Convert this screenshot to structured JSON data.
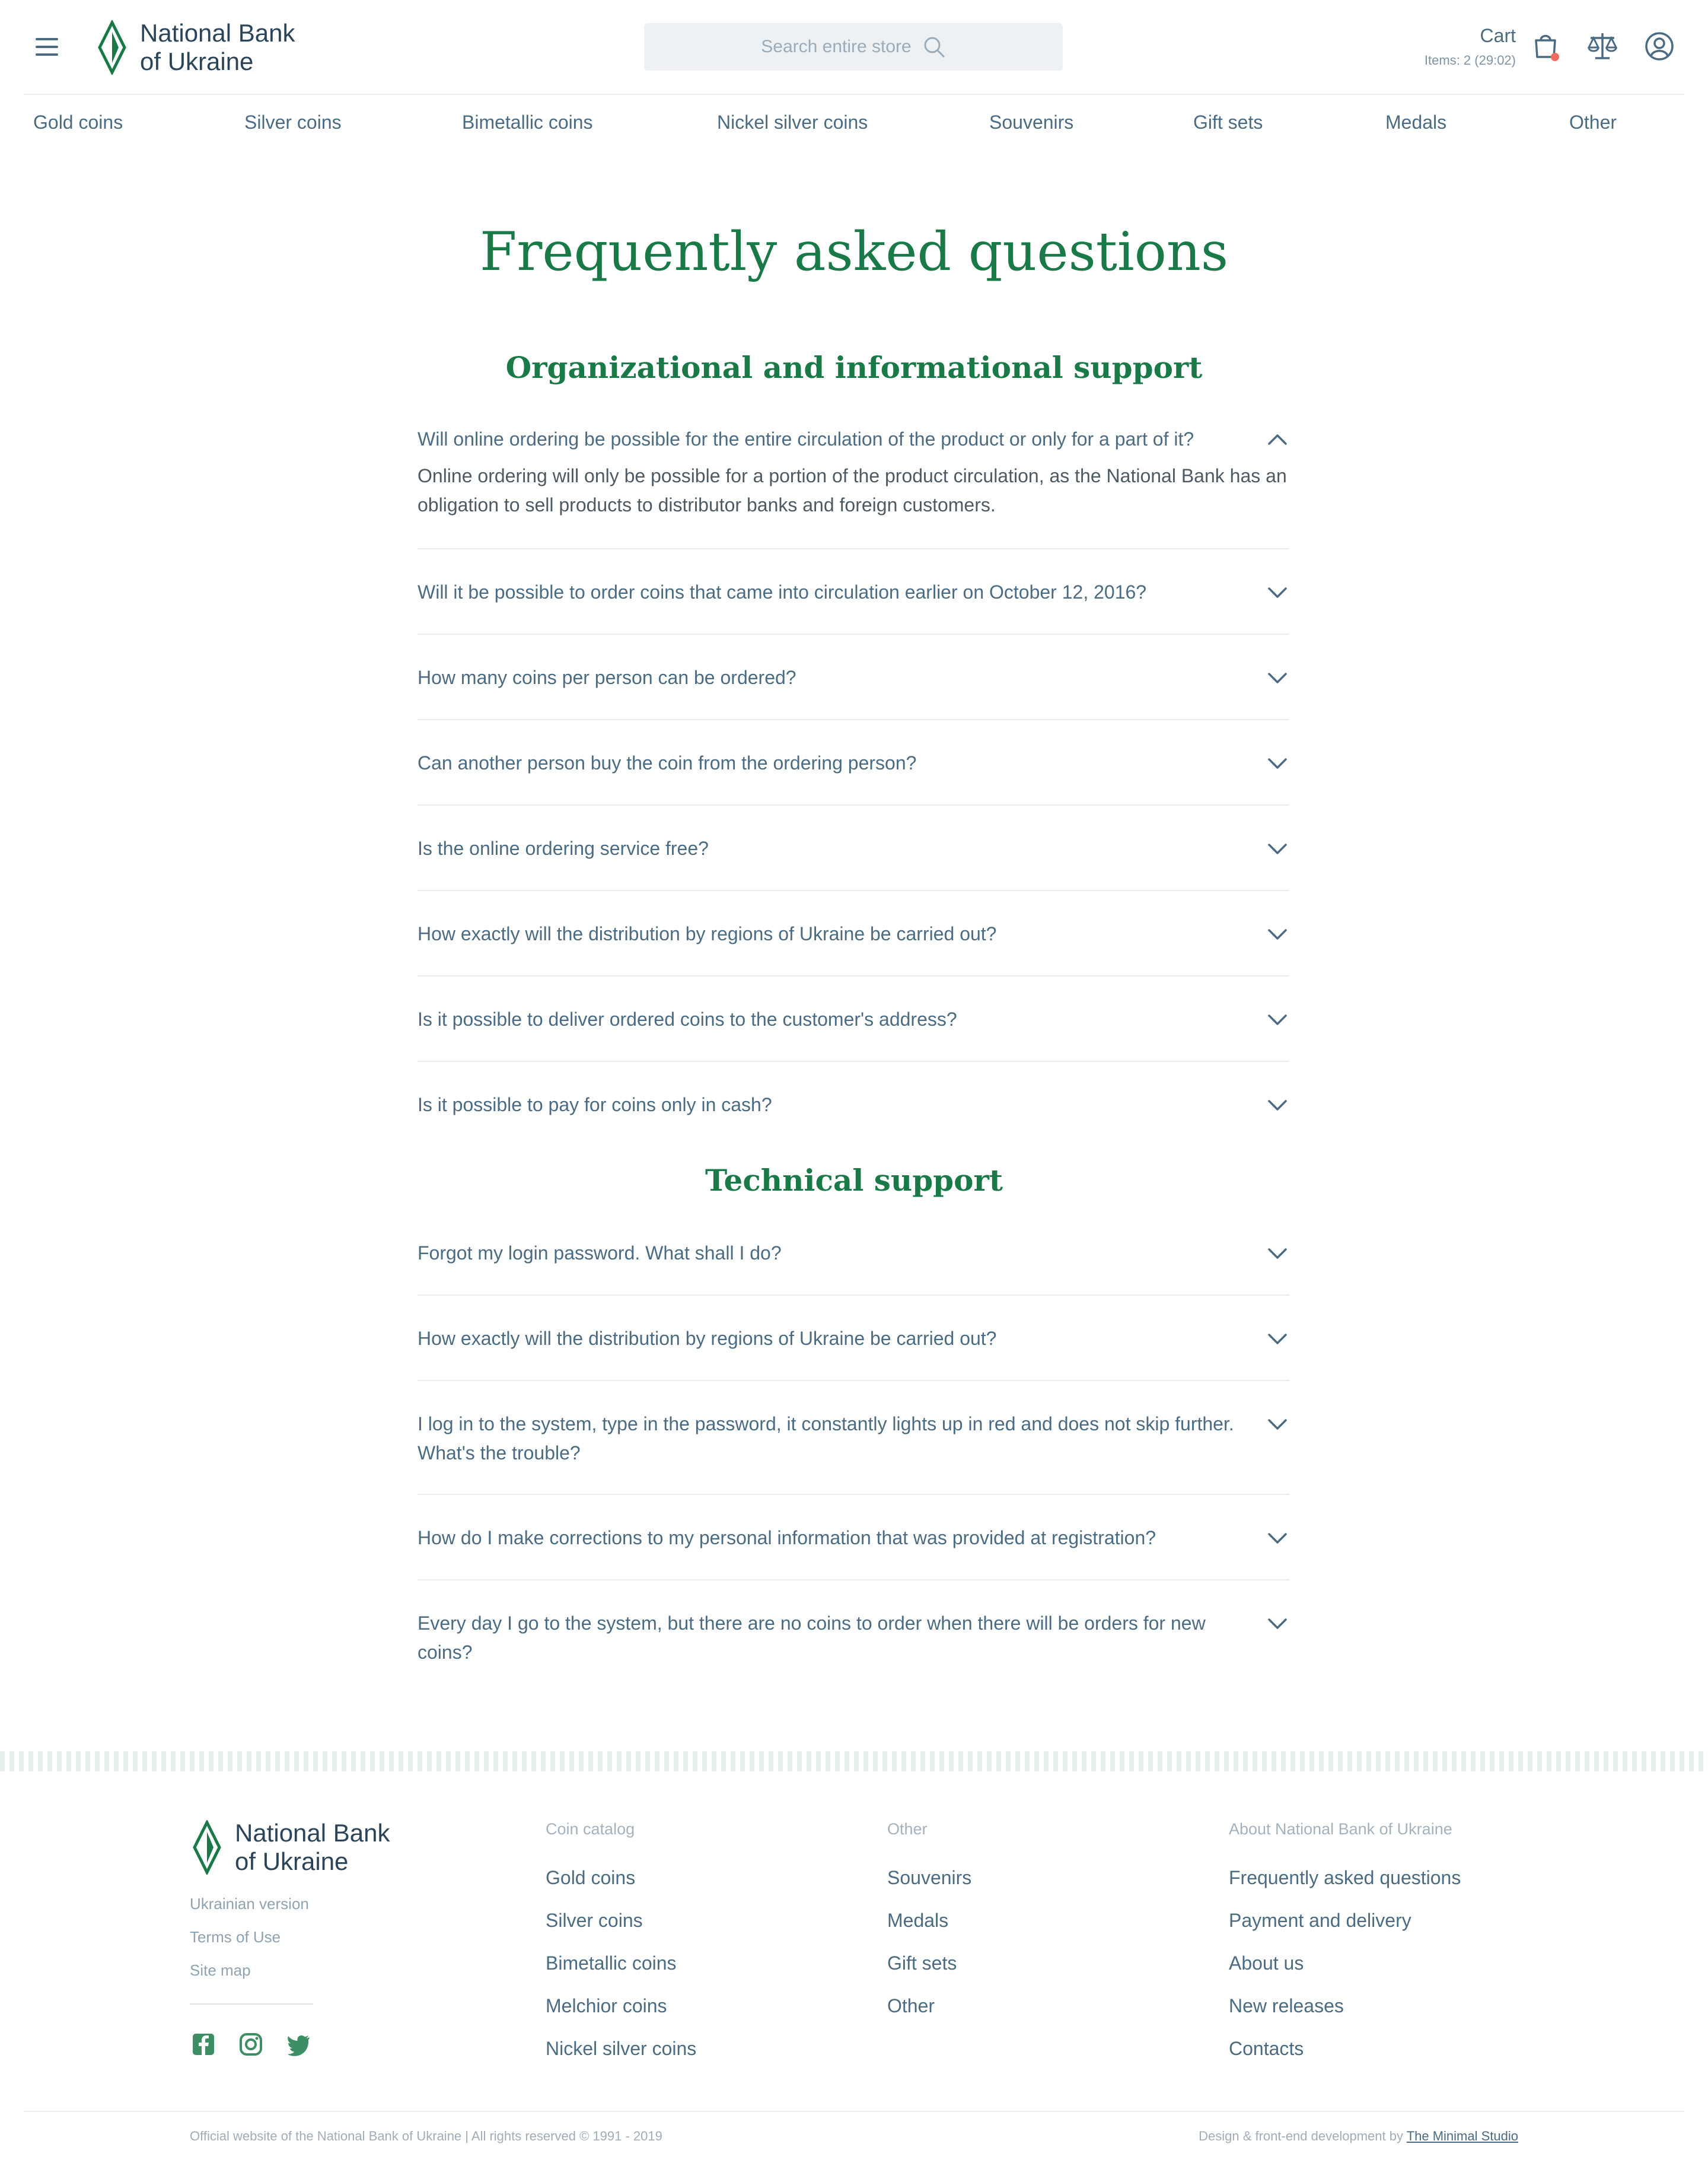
{
  "header": {
    "logo_line1": "National Bank",
    "logo_line2": "of Ukraine",
    "search_placeholder": "Search entire store",
    "cart_label": "Cart",
    "cart_items": "Items: 2 (29:02)",
    "accent_color": "#1a7a47",
    "badge_color": "#f06b5f"
  },
  "nav": {
    "items": [
      "Gold coins",
      "Silver coins",
      "Bimetallic coins",
      "Nickel silver coins",
      "Souvenirs",
      "Gift sets",
      "Medals",
      "Other"
    ]
  },
  "main": {
    "title": "Frequently asked questions",
    "sections": [
      {
        "title": "Organizational and informational support",
        "items": [
          {
            "question": "Will online ordering be possible for the entire circulation of the product or only for a part of it?",
            "answer": "Online ordering will only be possible for a portion of the product circulation, as the National Bank has an obligation to sell products to distributor banks and foreign customers.",
            "expanded": true
          },
          {
            "question": "Will it be possible to order coins that came into circulation earlier on October 12, 2016?",
            "expanded": false
          },
          {
            "question": "How many coins per person can be ordered?",
            "expanded": false
          },
          {
            "question": "Can another person buy the coin from the ordering person?",
            "expanded": false
          },
          {
            "question": "Is the online ordering service free?",
            "expanded": false
          },
          {
            "question": "How exactly will the distribution by regions of Ukraine be carried out?",
            "expanded": false
          },
          {
            "question": "Is it possible to deliver ordered coins to the customer's address?",
            "expanded": false
          },
          {
            "question": "Is it possible to pay for coins only in cash?",
            "expanded": false
          }
        ]
      },
      {
        "title": "Technical support",
        "items": [
          {
            "question": "Forgot my login password. What shall I do?",
            "expanded": false
          },
          {
            "question": "How exactly will the distribution by regions of Ukraine be carried out?",
            "expanded": false
          },
          {
            "question": "I log in to the system, type in the password, it constantly lights up in red and does not skip further. What's the trouble?",
            "expanded": false
          },
          {
            "question": "How do I make corrections to my personal information that was provided at registration?",
            "expanded": false
          },
          {
            "question": "Every day I go to the system, but there are no coins to order when there will be orders for new coins?",
            "expanded": false
          }
        ]
      }
    ]
  },
  "footer": {
    "logo_line1": "National Bank",
    "logo_line2": "of Ukraine",
    "side_links": [
      "Ukrainian version",
      "Terms of Use",
      "Site map"
    ],
    "social": [
      "facebook-icon",
      "instagram-icon",
      "twitter-icon"
    ],
    "columns": [
      {
        "heading": "Coin catalog",
        "links": [
          "Gold coins",
          "Silver coins",
          "Bimetallic coins",
          "Melchior coins",
          "Nickel silver coins"
        ]
      },
      {
        "heading": "Other",
        "links": [
          "Souvenirs",
          "Medals",
          "Gift sets",
          "Other"
        ]
      },
      {
        "heading": "About National Bank of Ukraine",
        "links": [
          "Frequently asked questions",
          "Payment and delivery",
          "About us",
          "New releases",
          "Contacts"
        ]
      }
    ],
    "copyright": "Official website of the National Bank of Ukraine | All rights reserved © 1991 - 2019",
    "credits_prefix": "Design & front-end development by ",
    "credits_link": "The Minimal Studio"
  }
}
